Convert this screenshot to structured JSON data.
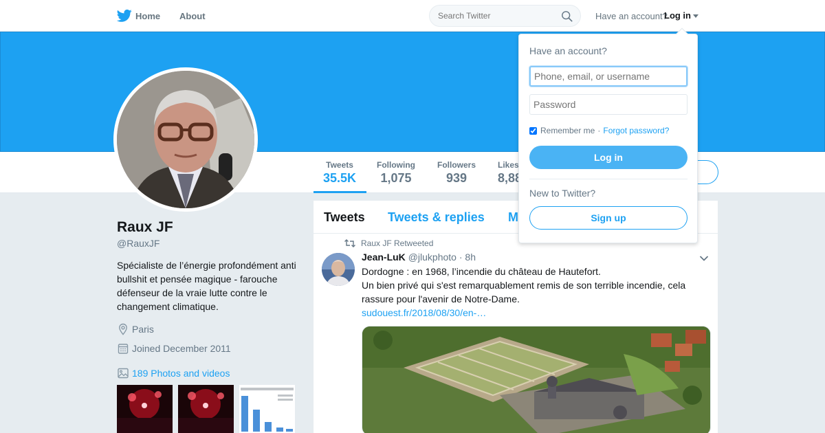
{
  "nav": {
    "home_label": "Home",
    "about_label": "About",
    "search_placeholder": "Search Twitter",
    "have_account": "Have an account?",
    "login_label": "Log in"
  },
  "profile": {
    "name": "Raux JF",
    "handle": "@RauxJF",
    "bio": "Spécialiste de l’énergie profondément anti bullshit et pensée magique - farouche défenseur de la vraie lutte contre le changement climatique.",
    "location": "Paris",
    "joined": "Joined December 2011",
    "photos_label": "189 Photos and videos"
  },
  "stats": [
    {
      "label": "Tweets",
      "value": "35.5K"
    },
    {
      "label": "Following",
      "value": "1,075"
    },
    {
      "label": "Followers",
      "value": "939"
    },
    {
      "label": "Likes",
      "value": "8,88"
    }
  ],
  "tabs": {
    "tweets": "Tweets",
    "replies": "Tweets & replies",
    "media": "M"
  },
  "tweet": {
    "retweet_label": "Raux JF Retweeted",
    "author": "Jean-LuK",
    "handle": "@jlukphoto",
    "dot": "·",
    "time": "8h",
    "line1": "Dordogne : en 1968, l’incendie du château de Hautefort.",
    "line2": "Un bien privé qui s'est remarquablement remis de son terrible incendie, cela rassure pour l'avenir de Notre-Dame.",
    "link": "sudouest.fr/2018/08/30/en-…"
  },
  "login_dropdown": {
    "title": "Have an account?",
    "username_placeholder": "Phone, email, or username",
    "password_placeholder": "Password",
    "remember_label": "Remember me",
    "separator": "·",
    "forgot_label": "Forgot password?",
    "login_button": "Log in",
    "new_label": "New to Twitter?",
    "signup_button": "Sign up"
  },
  "colors": {
    "brand_blue": "#1da1f2",
    "background": "#e6ecf0",
    "secondary_text": "#657786"
  }
}
